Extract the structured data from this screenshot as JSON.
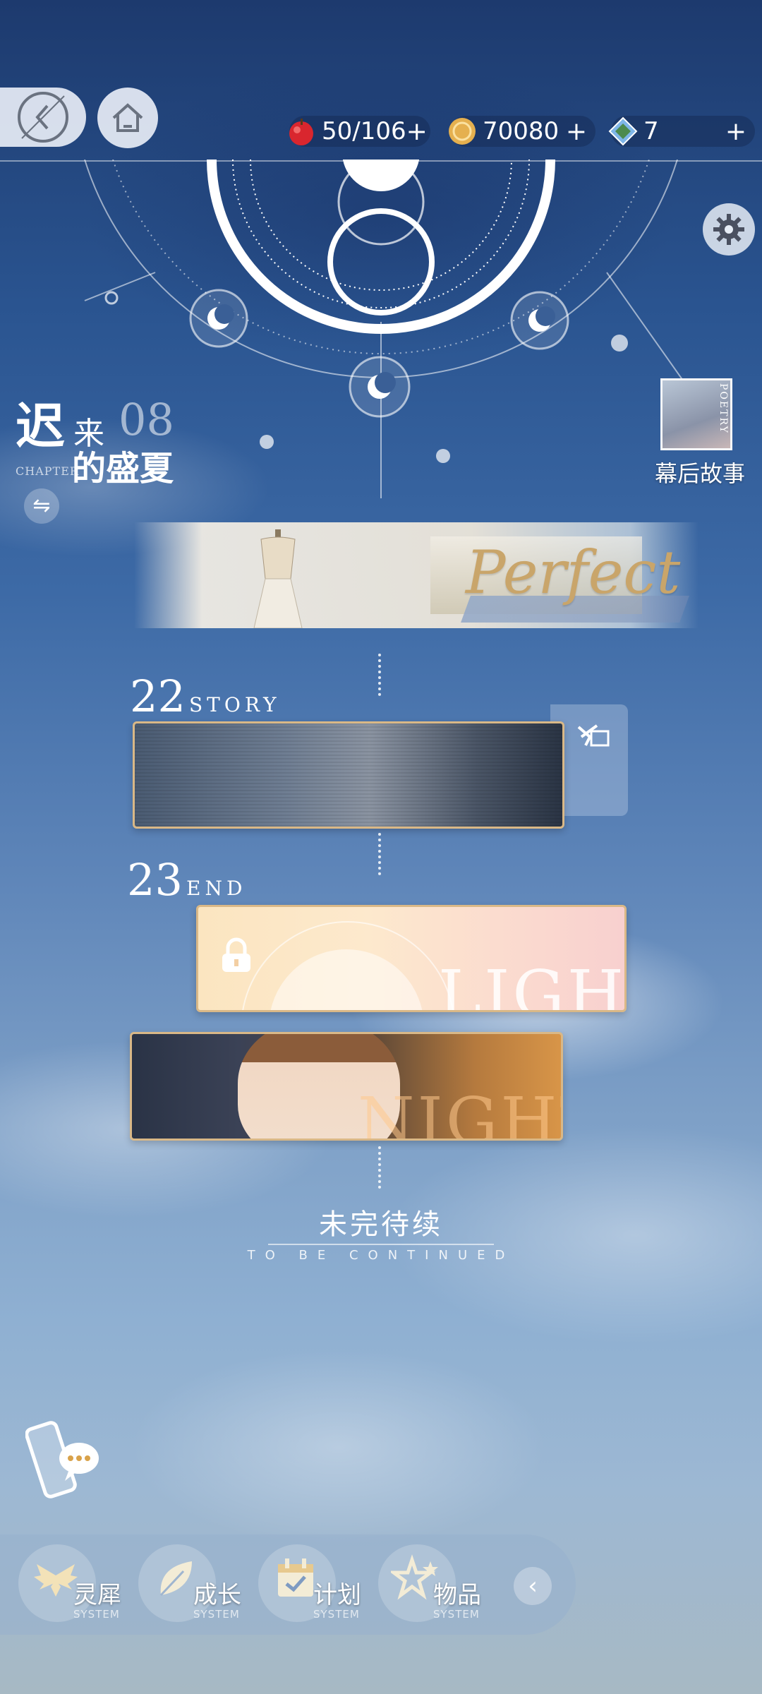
{
  "header": {
    "back_icon": "back-clock-icon",
    "home_icon": "home-icon",
    "resources": [
      {
        "icon": "apple-stamina-icon",
        "value": "50/106",
        "plus": "+"
      },
      {
        "icon": "gold-coin-icon",
        "value": "70080",
        "plus": "+"
      },
      {
        "icon": "diamond-icon",
        "value": "7",
        "plus": "+"
      }
    ]
  },
  "settings_icon": "gear-icon",
  "chapter": {
    "title_line1_big": "迟",
    "title_line1_small": "来",
    "title_line2": "的盛夏",
    "number": "08",
    "label": "CHAPTER"
  },
  "behind_the_scenes": {
    "thumb_text": "POETRY",
    "label": "幕后故事"
  },
  "banner": {
    "word": "Perfect"
  },
  "episodes": [
    {
      "number": "22",
      "tag": "STORY",
      "card_word": ""
    },
    {
      "number": "23",
      "tag": "END",
      "light_word": "LIGHT",
      "night_word": "NIGHT"
    }
  ],
  "to_be_continued": {
    "cn": "未完待续",
    "en": "TO BE CONTINUED"
  },
  "bottom_nav": [
    {
      "label": "灵犀",
      "sub": "SYSTEM",
      "icon": "wings-icon"
    },
    {
      "label": "成长",
      "sub": "SYSTEM",
      "icon": "leaf-icon"
    },
    {
      "label": "计划",
      "sub": "SYSTEM",
      "icon": "calendar-icon"
    },
    {
      "label": "物品",
      "sub": "SYSTEM",
      "icon": "star-items-icon"
    }
  ],
  "collapse_glyph": "‹",
  "colors": {
    "gold_border": "#d9b887",
    "sky_top": "#1d3a6e",
    "sky_bottom": "#a7b9c4"
  }
}
